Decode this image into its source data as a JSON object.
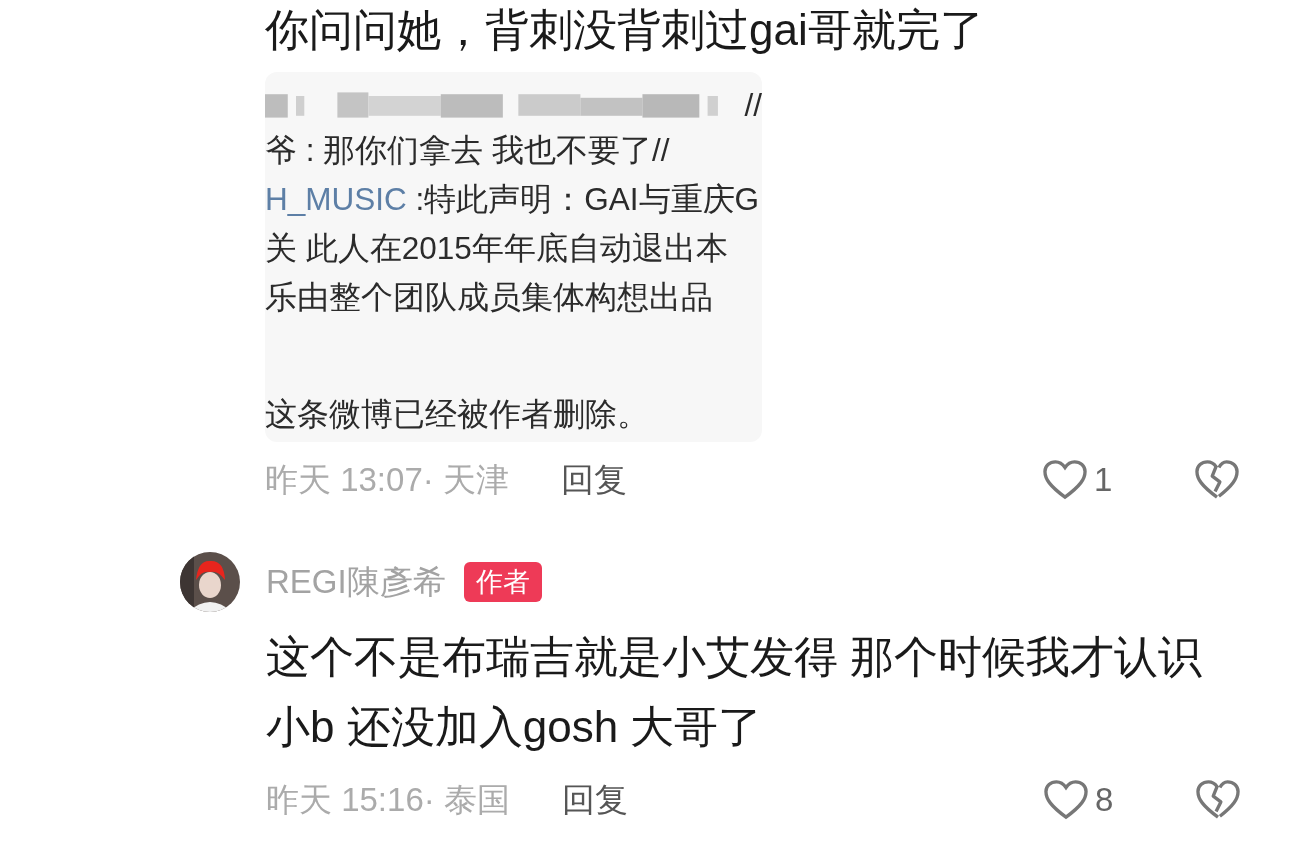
{
  "comments": [
    {
      "text": "你问问她，背刺没背刺过gai哥就完了",
      "attachment": {
        "lines": [
          {
            "kind": "blurred",
            "text": "//"
          },
          {
            "kind": "text",
            "text": "爷 : 那你们拿去 我也不要了//"
          },
          {
            "kind": "text",
            "mention": "H_MUSIC",
            "text": " :特此声明：GAI与重庆G"
          },
          {
            "kind": "text",
            "text": "关 此人在2015年年底自动退出本"
          },
          {
            "kind": "text",
            "text": "乐由整个团队成员集体构想出品"
          },
          {
            "kind": "notice",
            "text": "这条微博已经被作者删除。"
          }
        ]
      },
      "meta": "昨天 13:07· 天津",
      "reply": "回复",
      "likes": "1"
    },
    {
      "author": "REGI陳彥希",
      "badge": "作者",
      "text": "这个不是布瑞吉就是小艾发得 那个时候我才认识小b 还没加入gosh 大哥了",
      "meta": "昨天 15:16· 泰国",
      "reply": "回复",
      "likes": "8"
    }
  ]
}
